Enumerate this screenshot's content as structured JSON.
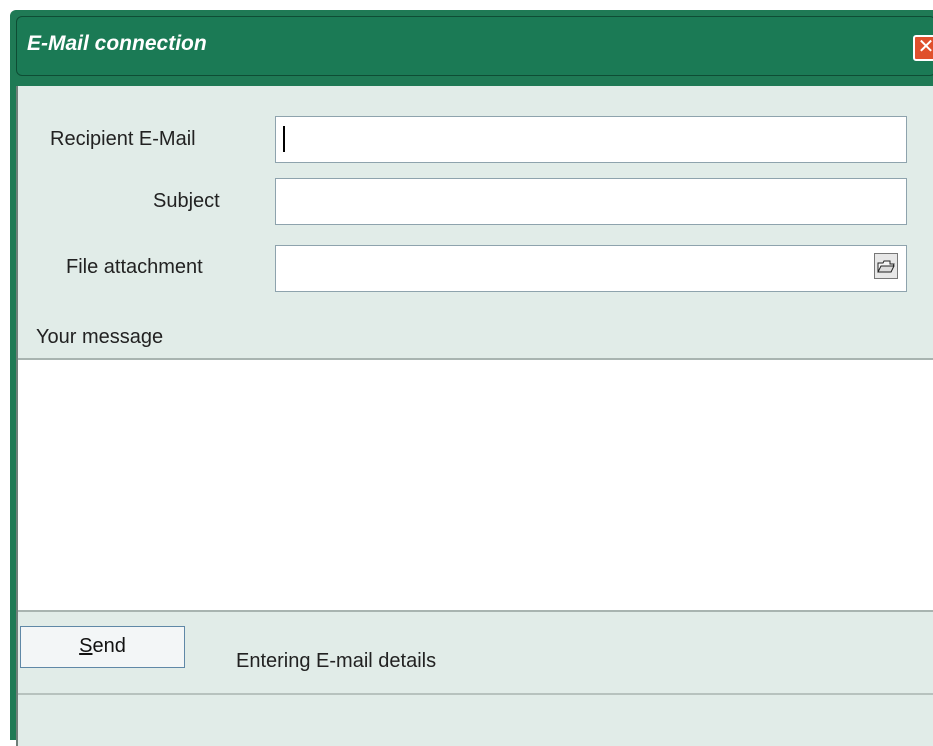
{
  "window": {
    "title": "E-Mail connection",
    "close_glyph": "✕"
  },
  "form": {
    "recipient_label": "Recipient E-Mail",
    "recipient_value": "",
    "subject_label": "Subject",
    "subject_value": "",
    "attachment_label": "File attachment",
    "attachment_value": "",
    "browse_icon": "folder-open-icon",
    "message_label": "Your message",
    "message_value": ""
  },
  "actions": {
    "send_label_first": "S",
    "send_label_rest": "end"
  },
  "status": {
    "text": "Entering E-mail details"
  },
  "colors": {
    "titlebar": "#1b7a55",
    "body": "#e1ece8",
    "close": "#e0502c"
  }
}
